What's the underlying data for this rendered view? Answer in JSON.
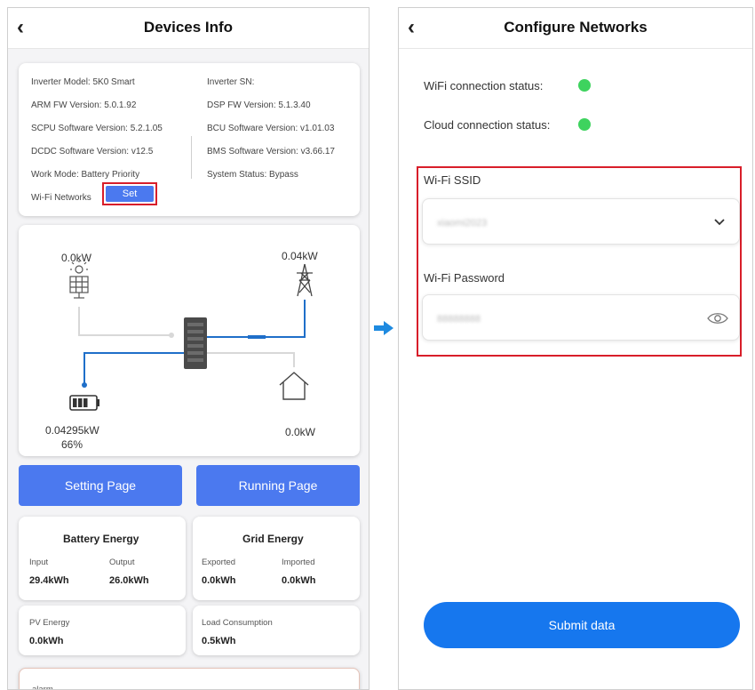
{
  "left": {
    "title": "Devices Info",
    "info": {
      "inverter_model": "Inverter Model:  5K0 Smart",
      "arm_fw": "ARM FW Version: 5.0.1.92",
      "scpu": "SCPU Software Version: 5.2.1.05",
      "dcdc": "DCDC Software Version: v12.5",
      "work_mode": "Work Mode: Battery Priority",
      "wifi_networks": "Wi-Fi Networks",
      "set_label": "Set",
      "inverter_sn": "Inverter SN:",
      "dsp_fw": "DSP FW Version: 5.1.3.40",
      "bcu": "BCU Software Version: v1.01.03",
      "bms": "BMS Software Version: v3.66.17",
      "system_status": "System Status: Bypass"
    },
    "flow": {
      "pv_power": "0.0kW",
      "grid_power": "0.04kW",
      "battery_power": "0.04295kW",
      "battery_soc": "66%",
      "load_power": "0.0kW",
      "pv_icon": "solar-panel-icon",
      "grid_icon": "power-tower-icon",
      "inverter_icon": "inverter-icon",
      "battery_icon": "battery-icon",
      "home_icon": "home-icon"
    },
    "buttons": {
      "setting": "Setting Page",
      "running": "Running Page"
    },
    "battery_energy": {
      "title": "Battery Energy",
      "input_label": "Input",
      "output_label": "Output",
      "input_value": "29.4kWh",
      "output_value": "26.0kWh"
    },
    "grid_energy": {
      "title": "Grid Energy",
      "exported_label": "Exported",
      "imported_label": "Imported",
      "exported_value": "0.0kWh",
      "imported_value": "0.0kWh"
    },
    "pv_energy": {
      "label": "PV Energy",
      "value": "0.0kWh"
    },
    "load_consumption": {
      "label": "Load Consumption",
      "value": "0.5kWh"
    },
    "alarm": "alarm"
  },
  "right": {
    "title": "Configure Networks",
    "wifi_status_label": "WiFi connection status:",
    "cloud_status_label": "Cloud connection status:",
    "ssid_label": "Wi-Fi SSID",
    "ssid_value": "xiaomi2023",
    "password_label": "Wi-Fi Password",
    "password_value": "88888888",
    "submit_label": "Submit data"
  },
  "colors": {
    "primary": "#4b79ef",
    "submit": "#1677ee",
    "status_ok": "#3ed35e",
    "highlight": "#d81e2a",
    "flow_active": "#1f6fc9",
    "flow_idle": "#d8d8d8"
  }
}
